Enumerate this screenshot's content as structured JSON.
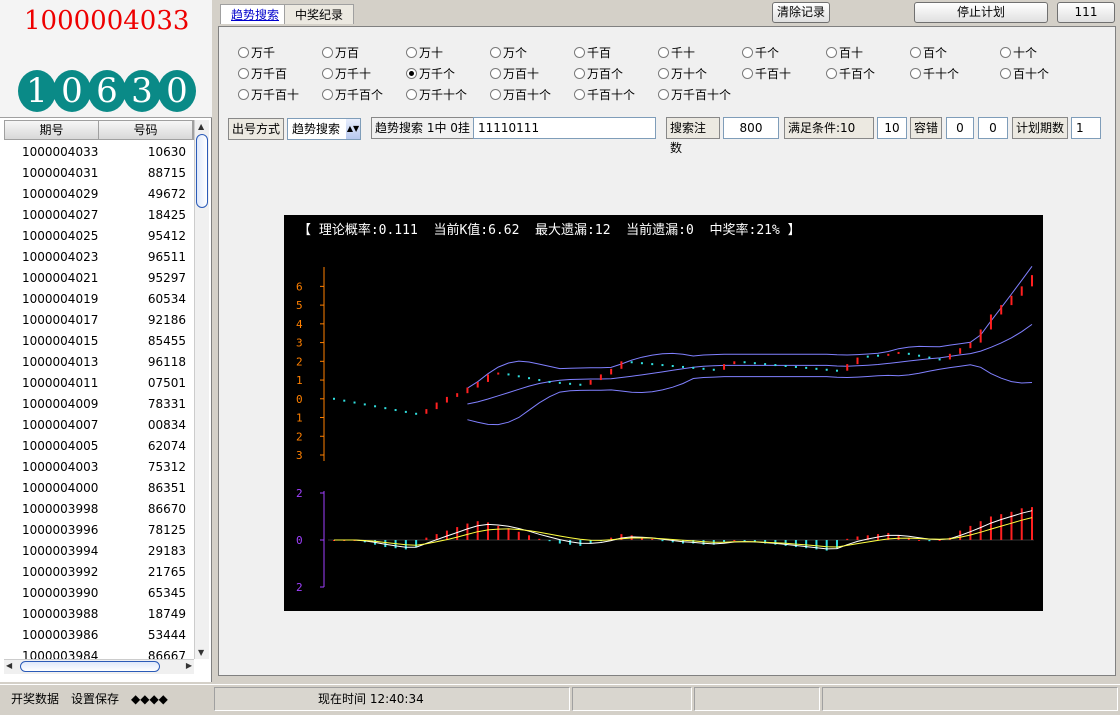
{
  "big_number": "1000004033",
  "digits": [
    "1",
    "0",
    "6",
    "3",
    "0"
  ],
  "table": {
    "headers": [
      "期号",
      "号码"
    ],
    "rows": [
      [
        "1000004033",
        "10630"
      ],
      [
        "1000004031",
        "88715"
      ],
      [
        "1000004029",
        "49672"
      ],
      [
        "1000004027",
        "18425"
      ],
      [
        "1000004025",
        "95412"
      ],
      [
        "1000004023",
        "96511"
      ],
      [
        "1000004021",
        "95297"
      ],
      [
        "1000004019",
        "60534"
      ],
      [
        "1000004017",
        "92186"
      ],
      [
        "1000004015",
        "85455"
      ],
      [
        "1000004013",
        "96118"
      ],
      [
        "1000004011",
        "07501"
      ],
      [
        "1000004009",
        "78331"
      ],
      [
        "1000004007",
        "00834"
      ],
      [
        "1000004005",
        "62074"
      ],
      [
        "1000004003",
        "75312"
      ],
      [
        "1000004000",
        "86351"
      ],
      [
        "1000003998",
        "86670"
      ],
      [
        "1000003996",
        "78125"
      ],
      [
        "1000003994",
        "29183"
      ],
      [
        "1000003992",
        "21765"
      ],
      [
        "1000003990",
        "65345"
      ],
      [
        "1000003988",
        "18749"
      ],
      [
        "1000003986",
        "53444"
      ],
      [
        "1000003984",
        "86667"
      ]
    ]
  },
  "tabs": [
    {
      "label": "趋势搜索",
      "active": true
    },
    {
      "label": "中奖纪录",
      "active": false
    }
  ],
  "toolbar": {
    "clear_label": "清除记录",
    "stop_label": "停止计划",
    "count": "111"
  },
  "options": {
    "row1": [
      "万千",
      "万百",
      "万十",
      "万个",
      "千百",
      "千十",
      "千个",
      "百十",
      "百个",
      "十个"
    ],
    "row2": [
      "万千百",
      "万千十",
      "万千个",
      "万百十",
      "万百个",
      "万十个",
      "千百十",
      "千百个",
      "千十个",
      "百十个"
    ],
    "row3": [
      "万千百十",
      "万千百个",
      "万千十个",
      "万百十个",
      "千百十个",
      "万千百十个"
    ],
    "selected": "万千个"
  },
  "controls": {
    "mode_label": "出号方式",
    "mode_value": "趋势搜索",
    "search_label": "趋势搜索 1中 0挂",
    "search_value": "11110111",
    "bets_label": "搜索注数",
    "bets_value": "800",
    "cond_label": "满足条件:10",
    "cond_value": "10",
    "tol_label": "容错",
    "tol_a": "0",
    "tol_b": "0",
    "plan_label": "计划期数",
    "plan_value": "1"
  },
  "chart_info": "【 理论概率:0.111  当前K值:6.62  最大遗漏:12  当前遗漏:0  中奖率:21% 】",
  "chart_data": {
    "type": "line",
    "upper_ticks": [
      "6",
      "5",
      "4",
      "3",
      "2",
      "1",
      "0",
      "1",
      "2",
      "3"
    ],
    "lower_ticks": [
      "2",
      "0",
      "2"
    ],
    "k_values": [
      0,
      -0.1,
      -0.2,
      -0.3,
      -0.4,
      -0.5,
      -0.6,
      -0.7,
      -0.8,
      -0.55,
      -0.2,
      0.1,
      0.3,
      0.6,
      0.9,
      1.3,
      1.4,
      1.3,
      1.2,
      1.1,
      1.0,
      0.9,
      0.85,
      0.8,
      0.75,
      1.0,
      1.3,
      1.6,
      2.0,
      1.95,
      1.9,
      1.85,
      1.8,
      1.75,
      1.7,
      1.65,
      1.6,
      1.55,
      1.85,
      2.0,
      1.95,
      1.9,
      1.85,
      1.8,
      1.75,
      1.7,
      1.65,
      1.6,
      1.55,
      1.5,
      1.85,
      2.2,
      2.25,
      2.3,
      2.4,
      2.5,
      2.4,
      2.3,
      2.2,
      2.1,
      2.4,
      2.7,
      3.0,
      3.7,
      4.5,
      5.0,
      5.5,
      6.0,
      6.6
    ],
    "macd": [
      0,
      0,
      0,
      -0.1,
      -0.2,
      -0.3,
      -0.35,
      -0.4,
      -0.3,
      0.1,
      0.25,
      0.4,
      0.55,
      0.7,
      0.8,
      0.75,
      0.6,
      0.5,
      0.35,
      0.2,
      0.05,
      -0.05,
      -0.15,
      -0.2,
      -0.25,
      -0.15,
      -0.05,
      0.1,
      0.25,
      0.2,
      0.1,
      0.05,
      -0.05,
      -0.1,
      -0.15,
      -0.15,
      -0.2,
      -0.2,
      -0.1,
      0,
      -0.05,
      -0.1,
      -0.15,
      -0.2,
      -0.25,
      -0.3,
      -0.35,
      -0.4,
      -0.45,
      -0.35,
      0.05,
      0.15,
      0.2,
      0.25,
      0.3,
      0.2,
      0.1,
      0,
      -0.05,
      0,
      0.1,
      0.4,
      0.6,
      0.8,
      1.0,
      1.1,
      1.2,
      1.35,
      1.4
    ],
    "ylim_upper": [
      -3,
      6.5
    ],
    "ylim_lower": [
      -2,
      2
    ]
  },
  "status": {
    "item1": "开奖数据",
    "item2": "设置保存",
    "item3": "◆◆◆◆",
    "time": "现在时间 12:40:34"
  },
  "colors": {
    "accent_red": "#e00000",
    "ball": "#0a8a87",
    "up": "#ff2020",
    "down": "#30e0e0",
    "band": "#8080ff"
  }
}
